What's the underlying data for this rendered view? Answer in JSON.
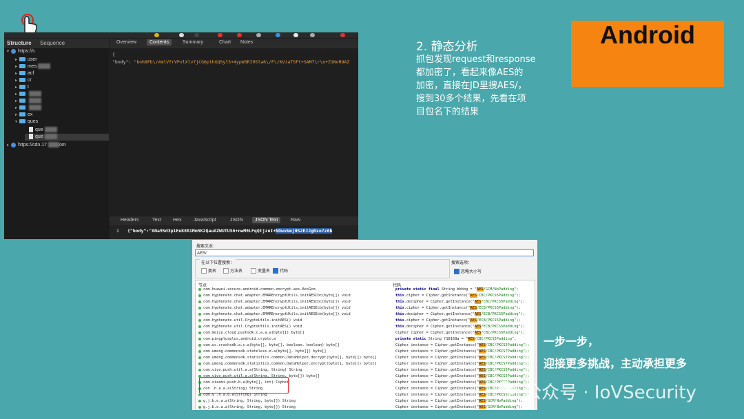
{
  "charles": {
    "tabs": [
      "Structure",
      "Sequence"
    ],
    "top_tabs": [
      "Overview",
      "Contents",
      "Summary",
      "Chart",
      "Notes"
    ],
    "top_tab_selected": "Contents",
    "tree": [
      {
        "label": "https://s",
        "type": "globe",
        "expanded": true
      },
      {
        "label": "user",
        "type": "folder"
      },
      {
        "label": "mes",
        "type": "folder"
      },
      {
        "label": "acf",
        "type": "folder"
      },
      {
        "label": "cr",
        "type": "folder"
      },
      {
        "label": "t",
        "type": "folder"
      },
      {
        "label": "",
        "type": "folder"
      },
      {
        "label": "",
        "type": "folder"
      },
      {
        "label": "",
        "type": "folder"
      },
      {
        "label": "ex",
        "type": "folder"
      },
      {
        "label": "ques",
        "type": "folder",
        "expanded": true
      },
      {
        "label": "que",
        "type": "file"
      },
      {
        "label": "que",
        "type": "file"
      },
      {
        "label": "https://cdn.17",
        "type": "globe",
        "suffix": "om"
      }
    ],
    "resp_open": "{",
    "resp_key": "\"body\"",
    "resp_value": "\"koh8Fb\\/4mlVfrVPvlXlv7jCG6pthGQ5ylS+4ypW3RI9Sla6\\/F\\/KViaTSFt+SAM7\\r\\n+Z1NoR9AZ",
    "bottom_tabs": [
      "Headers",
      "Text",
      "Hex",
      "JavaScript",
      "JSON",
      "JSON Text",
      "Raw"
    ],
    "bottom_tab_selected": "JSON Text",
    "json_line_no": "1",
    "json_text_plain": "{\"body\":\"ANa9Sd3p1EuK8R1Mm5K2QauAZWUTUS6+nwM9LFqQtjznI+",
    "json_text_highlight": "NOwvkmjHS2EJJgRxo7z6b"
  },
  "slide": {
    "title": "2. 静态分析",
    "desc_lines": [
      "抓包发现request和response",
      "都加密了，看起来像AES的",
      "加密，直接在JD里搜AES/，",
      "搜到30多个结果，先看在项",
      "目包名下的结果"
    ],
    "badge": "Android",
    "slogan_line1": "一步一步，",
    "slogan_line2": "迎接更多挑战，主动承担更多",
    "watermark": "公众号 · IoVSecurity"
  },
  "colors": {
    "background": "#4aa7ab",
    "badge": "#f58410",
    "highlight": "#f5a623",
    "red_box": "#e02020"
  },
  "jd": {
    "search_label": "搜索文本：",
    "search_value": "AES/",
    "group_title": "在以下位置搜索：",
    "checks": [
      {
        "label": "类名",
        "checked": false
      },
      {
        "label": "方法名",
        "checked": false
      },
      {
        "label": "变量名",
        "checked": false
      },
      {
        "label": "代码",
        "checked": true
      }
    ],
    "options_title": "搜索选项：",
    "options_check": "忽略大小写",
    "col1": "节点",
    "col2": "代码",
    "rows": [
      {
        "cls": "com.huawei.secure.android.common.encrypt.aes.AesGcm",
        "pre": "private static final String bbbbg = \"",
        "aes": "AES",
        "post": "/GCM/NoPadding\";",
        "kw": true
      },
      {
        "cls": "com.hyphenate.chat.adapter.EMAREncryptUtils.initAESCbc(byte[]) void",
        "pre": "this.cipher = Cipher.getInstance(\"",
        "aes": "AES",
        "post": "/CBC/PKCS5Padding\");",
        "kw": true
      },
      {
        "cls": "com.hyphenate.chat.adapter.EMAREncryptUtils.initAESCbc(byte[]) void",
        "pre": "this.decipher = Cipher.getInstance(\"",
        "aes": "AES",
        "post": "/CBC/PKCS5Padding\");",
        "kw": true
      },
      {
        "cls": "com.hyphenate.chat.adapter.EMAREncryptUtils.initAESEcb(byte[]) void",
        "pre": "this.cipher = Cipher.getInstance(\"",
        "aes": "AES",
        "post": "/ECB/PKCS5Padding\");",
        "kw": true
      },
      {
        "cls": "com.hyphenate.chat.adapter.EMAREncryptUtils.initAESEcb(byte[]) void",
        "pre": "this.decipher = Cipher.getInstance(\"",
        "aes": "AES",
        "post": "/ECB/PKCS5Padding\");",
        "kw": true
      },
      {
        "cls": "com.hyphenate.util.CryptoUtils.initAES() void",
        "pre": "this.cipher = Cipher.getInstance(\"",
        "aes": "AES",
        "post": "/ECB/PKCS5Padding\");",
        "kw": true
      },
      {
        "cls": "com.hyphenate.util.CryptoUtils.initAES() void",
        "pre": "this.decipher = Cipher.getInstance(\"",
        "aes": "AES",
        "post": "/ECB/PKCS5Padding\");",
        "kw": true
      },
      {
        "cls": "com.meizu.cloud.pushsdk.c.a.a.a(byte[]) byte[]",
        "pre": "Cipher cipher = Cipher.getInstance(\"",
        "aes": "AES",
        "post": "/CBC/PKCS5Padding\");",
        "kw": false
      },
      {
        "cls": "com.pingplusplus.android.crypto.a",
        "pre": "private static String f18168a = \"",
        "aes": "AES",
        "post": "/CBC/PKCS5Padding\";",
        "kw": true
      },
      {
        "cls": "com.uc.crashsdk.a.c.a(byte[], byte[], boolean, boolean) byte[]",
        "pre": "Cipher instance = Cipher.getInstance(\"",
        "aes": "AES",
        "post": "/CBC/PKCS5Padding\");",
        "kw": false
      },
      {
        "cls": "com.umeng.commonsdk.stateless.d.a(byte[], byte[]) byte[]",
        "pre": "Cipher instance = Cipher.getInstance(\"",
        "aes": "AES",
        "post": "/CBC/PKCS7Padding\");",
        "kw": false
      },
      {
        "cls": "com.umeng.commonsdk.statistics.common.DataHelper.decrypt(byte[], byte[]) byte[]",
        "pre": "Cipher instance = Cipher.getInstance(\"",
        "aes": "AES",
        "post": "/CBC/PKCS7Padding\");",
        "kw": false
      },
      {
        "cls": "com.umeng.commonsdk.statistics.common.DataHelper.encrypt(byte[], byte[]) byte[]",
        "pre": "Cipher instance = Cipher.getInstance(\"",
        "aes": "AES",
        "post": "/CBC/PKCS7Padding\");",
        "kw": false
      },
      {
        "cls": "com.vivo.push.util.a.a(String, String) String",
        "pre": "Cipher instance = Cipher.getInstance(\"",
        "aes": "AES",
        "post": "/CBC/PKCS5Padding\");",
        "kw": false
      },
      {
        "cls": "com.vivo.push.util.a.a(String, String, byte[]) byte[]",
        "pre": "Cipher instance = Cipher.getInstance(\"",
        "aes": "AES",
        "post": "/CBC/PKCS5Padding\");",
        "kw": false
      },
      {
        "cls": "com.xiaomi.push.b.a(byte[], int) Cipher",
        "pre": "Cipher instance = Cipher.getInstance(\"",
        "aes": "AES",
        "post": "/CBC/PKCS5Padding\");",
        "kw": false
      },
      {
        "cls": "con        .h.a.a.a(String) String",
        "pre": "Cipher instance = Cipher.getInstance(\"",
        "aes": "AES",
        "post": "/CBC/PKCS5Padding\");",
        "kw": false
      },
      {
        "cls": "com.y      .h.a.b.a(String) String",
        "pre": "Cipher instance = Cipher.getInstance(\"",
        "aes": "AES",
        "post": "/CBC/PKCS5Padding\");",
        "kw": false
      },
      {
        "cls": "g.j.b.e.a.a(String, String, byte[]) String",
        "pre": "Cipher instance = Cipher.getInstance(\"",
        "aes": "AES",
        "post": "/GCM/NoPadding\");",
        "kw": false
      },
      {
        "cls": "g.j.b.e.a.a(String, String, byte[]) String",
        "pre": "Cipher instance = Cipher.getInstance(\"",
        "aes": "AES",
        "post": "/GCM/NoPadding\");",
        "kw": false
      }
    ]
  }
}
